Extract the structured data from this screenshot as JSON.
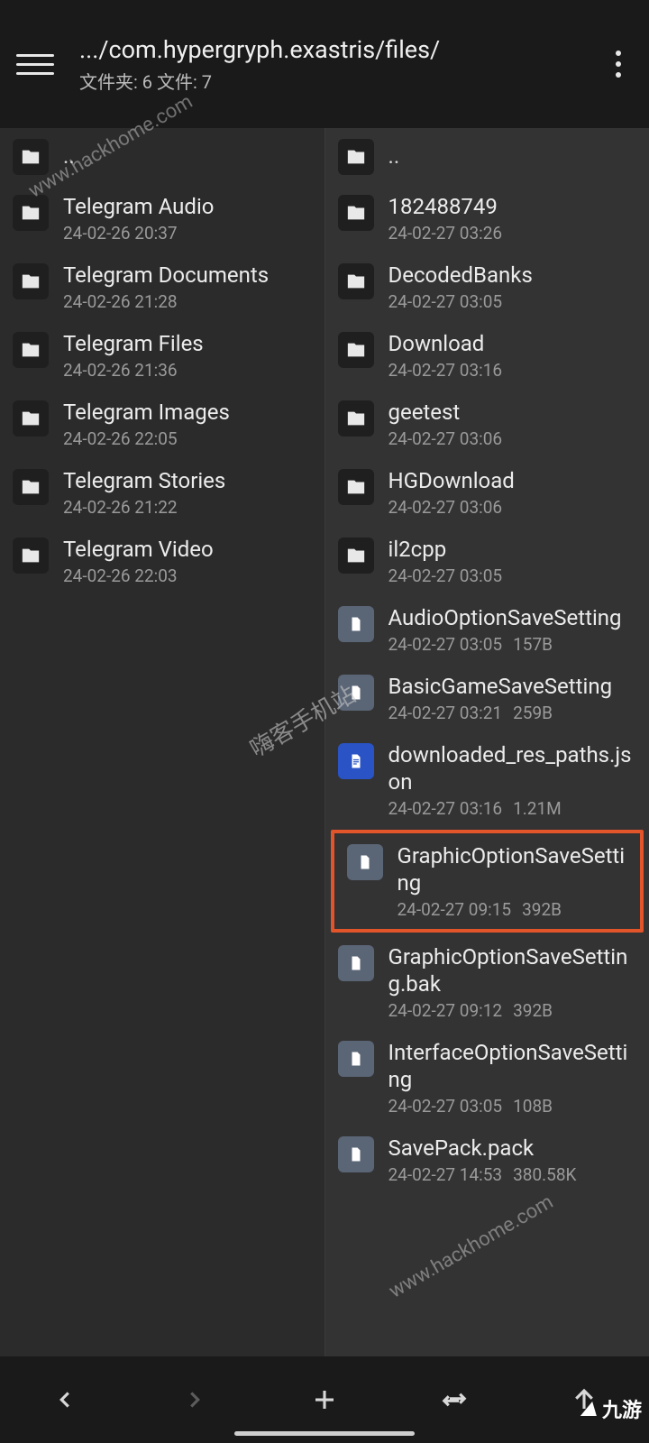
{
  "header": {
    "path": ".../com.hypergryph.exastris/files/",
    "subtitle": "文件夹: 6  文件: 7"
  },
  "parent_label": "..",
  "left_pane": [
    {
      "name": "Telegram Audio",
      "date": "24-02-26 20:37",
      "type": "folder"
    },
    {
      "name": "Telegram Documents",
      "date": "24-02-26 21:28",
      "type": "folder"
    },
    {
      "name": "Telegram Files",
      "date": "24-02-26 21:36",
      "type": "folder"
    },
    {
      "name": "Telegram Images",
      "date": "24-02-26 22:05",
      "type": "folder"
    },
    {
      "name": "Telegram Stories",
      "date": "24-02-26 21:22",
      "type": "folder"
    },
    {
      "name": "Telegram Video",
      "date": "24-02-26 22:03",
      "type": "folder"
    }
  ],
  "right_pane": [
    {
      "name": "182488749",
      "date": "24-02-27 03:26",
      "type": "folder"
    },
    {
      "name": "DecodedBanks",
      "date": "24-02-27 03:05",
      "type": "folder"
    },
    {
      "name": "Download",
      "date": "24-02-27 03:16",
      "type": "folder"
    },
    {
      "name": "geetest",
      "date": "24-02-27 03:06",
      "type": "folder"
    },
    {
      "name": "HGDownload",
      "date": "24-02-27 03:06",
      "type": "folder"
    },
    {
      "name": "il2cpp",
      "date": "24-02-27 03:05",
      "type": "folder"
    },
    {
      "name": "AudioOptionSaveSetting",
      "date": "24-02-27 03:05",
      "size": "157B",
      "type": "file-grey"
    },
    {
      "name": "BasicGameSaveSetting",
      "date": "24-02-27 03:21",
      "size": "259B",
      "type": "file-grey"
    },
    {
      "name": "downloaded_res_paths.json",
      "date": "24-02-27 03:16",
      "size": "1.21M",
      "type": "file-blue"
    },
    {
      "name": "GraphicOptionSaveSetting",
      "date": "24-02-27 09:15",
      "size": "392B",
      "type": "file-grey",
      "highlighted": true
    },
    {
      "name": "GraphicOptionSaveSetting.bak",
      "date": "24-02-27 09:12",
      "size": "392B",
      "type": "file-grey"
    },
    {
      "name": "InterfaceOptionSaveSetting",
      "date": "24-02-27 03:05",
      "size": "108B",
      "type": "file-grey"
    },
    {
      "name": "SavePack.pack",
      "date": "24-02-27 14:53",
      "size": "380.58K",
      "type": "file-grey"
    }
  ],
  "watermarks": {
    "hack1": "www.hackhome.com",
    "cn": "嗨客手机站",
    "hack2": "www.hackhome.com",
    "logo": "九游"
  }
}
